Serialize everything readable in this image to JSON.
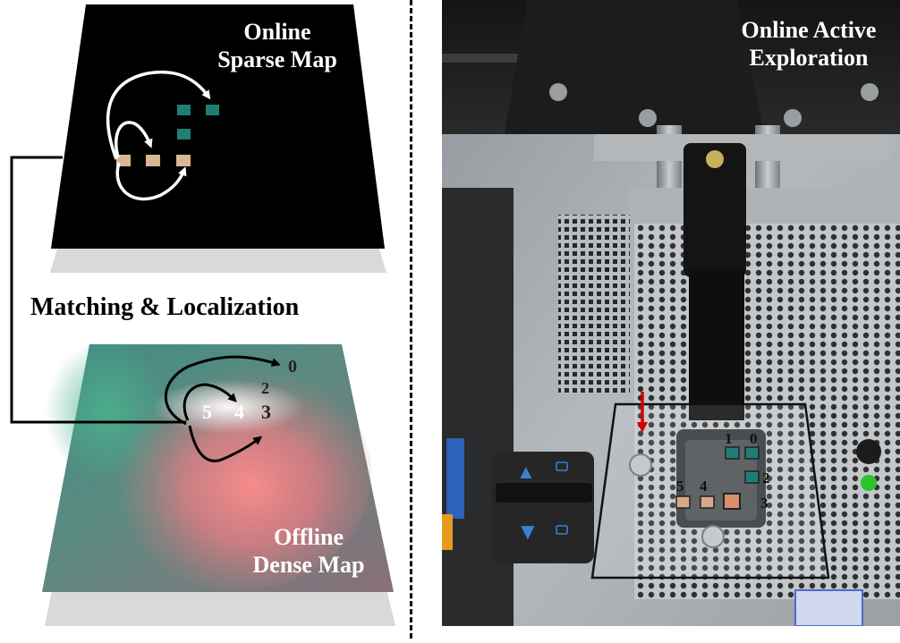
{
  "left_panel": {
    "sparse_map": {
      "title_line1": "Online",
      "title_line2": "Sparse Map",
      "background": "#000000"
    },
    "matching_label": "Matching & Localization",
    "dense_map": {
      "title_line1": "Offline",
      "title_line2": "Dense Map",
      "cell_labels": [
        "5",
        "4",
        "3",
        "2",
        "0"
      ]
    }
  },
  "right_panel": {
    "title_line1": "Online Active",
    "title_line2": "Exploration",
    "cell_labels": [
      "1",
      "0",
      "2",
      "5",
      "4",
      "3"
    ],
    "push_arrow_color": "#d40000",
    "up_arrow_glyph": "▲",
    "down_arrow_glyph": "▼"
  },
  "colors": {
    "teal_cell": "#1e7e74",
    "tan_cell": "#d8b890",
    "divider": "#000000"
  }
}
